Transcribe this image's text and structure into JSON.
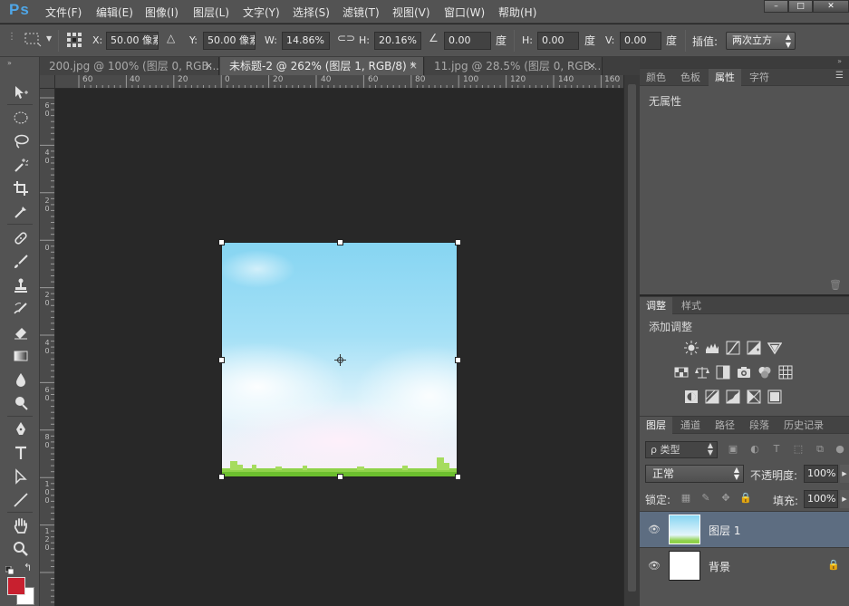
{
  "app": {
    "logo": "Ps"
  },
  "menu": [
    "文件(F)",
    "编辑(E)",
    "图像(I)",
    "图层(L)",
    "文字(Y)",
    "选择(S)",
    "滤镜(T)",
    "视图(V)",
    "窗口(W)",
    "帮助(H)"
  ],
  "window_controls": {
    "minimize": "–",
    "maximize": "□",
    "close": "✕"
  },
  "options": {
    "x_label": "X:",
    "x_value": "50.00 像素",
    "y_label": "Y:",
    "y_value": "50.00 像素",
    "w_label": "W:",
    "w_value": "14.86%",
    "h_label": "H:",
    "h_value": "20.16%",
    "angle_value": "0.00",
    "angle_unit": "度",
    "hskew_label": "H:",
    "hskew_value": "0.00",
    "hskew_unit": "度",
    "vskew_label": "V:",
    "vskew_value": "0.00",
    "vskew_unit": "度",
    "interp_label": "插值:",
    "interp_value": "两次立方"
  },
  "tabs": [
    {
      "label": "200.jpg @ 100% (图层 0, RGB...",
      "close": "×",
      "active": false
    },
    {
      "label": "未标题-2 @ 262% (图层 1, RGB/8) *",
      "close": "×",
      "active": true
    },
    {
      "label": "11.jpg @ 28.5% (图层 0, RGB...",
      "close": "×",
      "active": false
    }
  ],
  "rulers": {
    "top": [
      "60",
      "40",
      "20",
      "0",
      "20",
      "40",
      "60",
      "80",
      "100",
      "120",
      "140",
      "160"
    ],
    "left": [
      "60",
      "40",
      "20",
      "0",
      "20",
      "40",
      "60",
      "80",
      "100",
      "120"
    ]
  },
  "panel_properties": {
    "tabs": [
      "颜色",
      "色板",
      "属性",
      "字符"
    ],
    "active_tab": "属性",
    "content": "无属性"
  },
  "panel_adjustments": {
    "tabs": [
      "调整",
      "样式"
    ],
    "title": "添加调整",
    "icons": [
      "brightness-icon",
      "levels-icon",
      "curves-icon",
      "exposure-icon",
      "vibrance-icon",
      "hue-saturation-icon",
      "color-balance-icon",
      "black-white-icon",
      "photo-filter-icon",
      "channel-mixer-icon",
      "color-lookup-icon",
      "invert-icon",
      "posterize-icon",
      "threshold-icon",
      "gradient-map-icon",
      "selective-color-icon"
    ]
  },
  "panel_layers": {
    "tabs": [
      "图层",
      "通道",
      "路径",
      "段落",
      "历史记录"
    ],
    "filter_label": "ρ 类型",
    "blend_mode": "正常",
    "opacity_label": "不透明度:",
    "opacity_value": "100%",
    "lock_label": "锁定:",
    "fill_label": "填充:",
    "fill_value": "100%",
    "layers": [
      {
        "name": "图层 1",
        "selected": true,
        "locked": false
      },
      {
        "name": "背景",
        "selected": false,
        "locked": true
      }
    ]
  },
  "colors": {
    "foreground": "#c8202f",
    "background": "#ffffff",
    "accent": "#4fa7e8",
    "selected_layer": "#5d6d81"
  }
}
